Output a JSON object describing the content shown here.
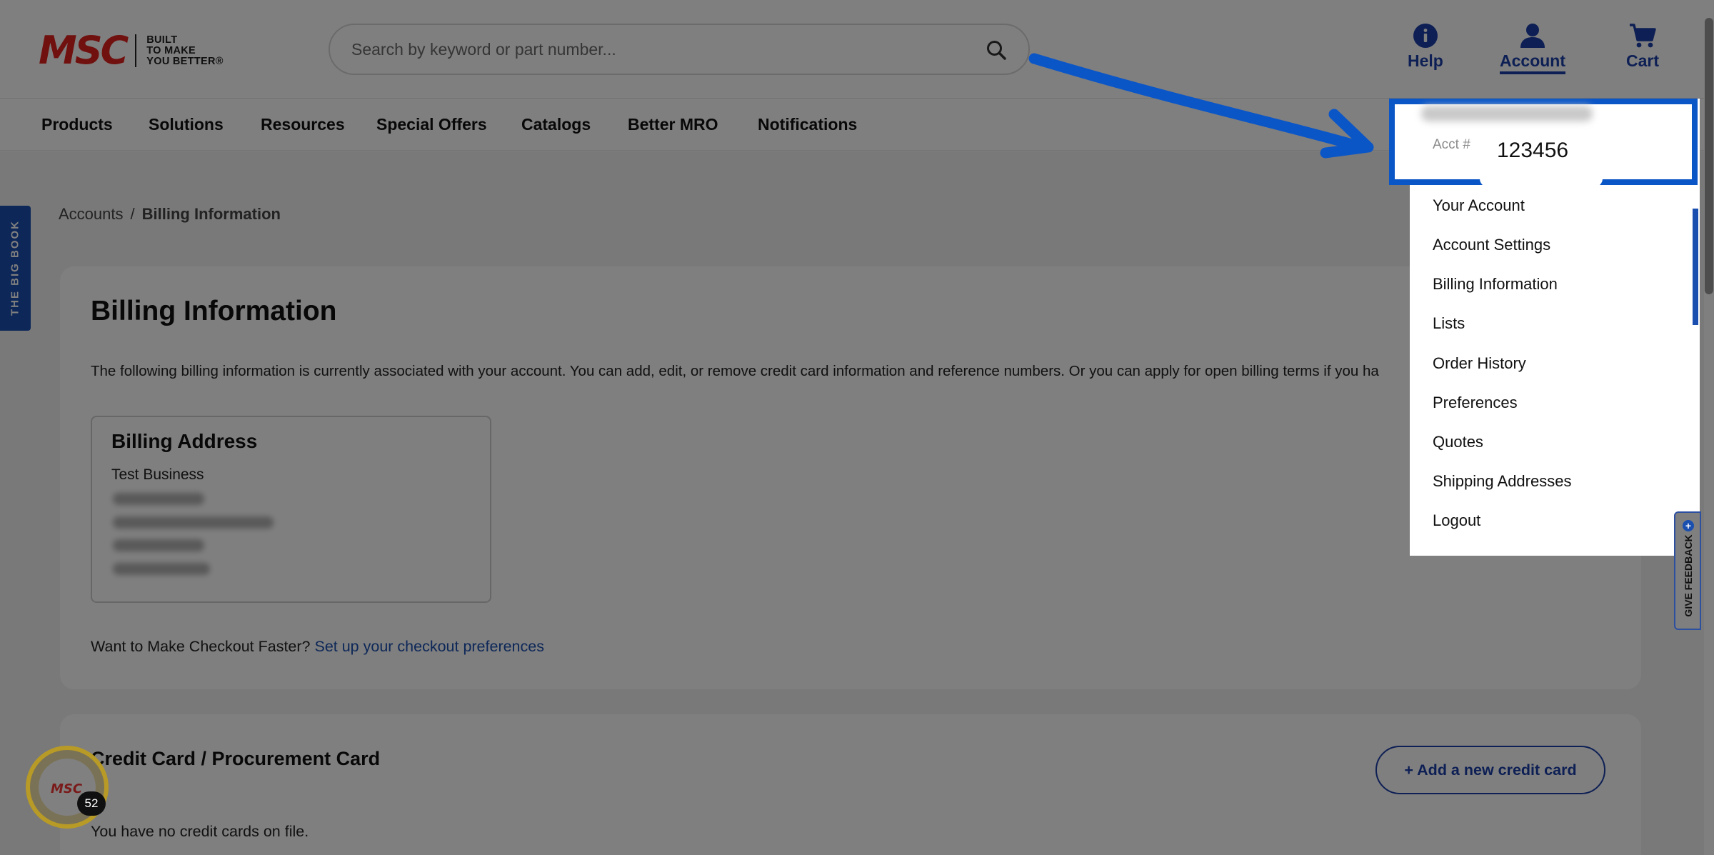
{
  "header": {
    "logo": {
      "mark": "MSC",
      "tagline": [
        "BUILT",
        "TO MAKE",
        "YOU BETTER®"
      ]
    },
    "search": {
      "placeholder": "Search by keyword or part number...",
      "value": ""
    },
    "help_label": "Help",
    "account_label": "Account",
    "cart_label": "Cart"
  },
  "nav": {
    "items": [
      "Products",
      "Solutions",
      "Resources",
      "Special Offers",
      "Catalogs",
      "Better MRO",
      "Notifications"
    ]
  },
  "side_tab": {
    "label": "THE BIG BOOK"
  },
  "breadcrumb": {
    "items": [
      "Accounts",
      "Billing Information"
    ],
    "separator": "/"
  },
  "main": {
    "title": "Billing Information",
    "intro": "The following billing information is currently associated with your account. You can add, edit, or remove credit card information and reference numbers. Or you can apply for open billing terms if you ha",
    "billing_address": {
      "title": "Billing Address",
      "business": "Test Business"
    },
    "checkout_prompt": "Want to Make Checkout Faster?",
    "checkout_link": "Set up your checkout preferences",
    "credit_card": {
      "title": "Credit Card / Procurement Card",
      "add_label": "+ Add a new credit card",
      "empty_text": "You have no credit cards on file."
    }
  },
  "account_menu": {
    "acct_label": "Acct #",
    "acct_number": "123456",
    "items": [
      "Your Account",
      "Account Settings",
      "Billing Information",
      "Lists",
      "Order History",
      "Preferences",
      "Quotes",
      "Shipping Addresses",
      "Logout"
    ]
  },
  "feedback": {
    "label": "GIVE FEEDBACK"
  },
  "rewards": {
    "logo": "MSC",
    "count": "52"
  },
  "colors": {
    "brand_red": "#e0221f",
    "brand_blue": "#1a3fa8",
    "highlight_blue": "#0b56c7",
    "overlay": "rgba(0,0,0,0.5)"
  },
  "icons": [
    "search-icon",
    "help-icon",
    "account-icon",
    "cart-icon",
    "arrow-annotation-icon"
  ]
}
